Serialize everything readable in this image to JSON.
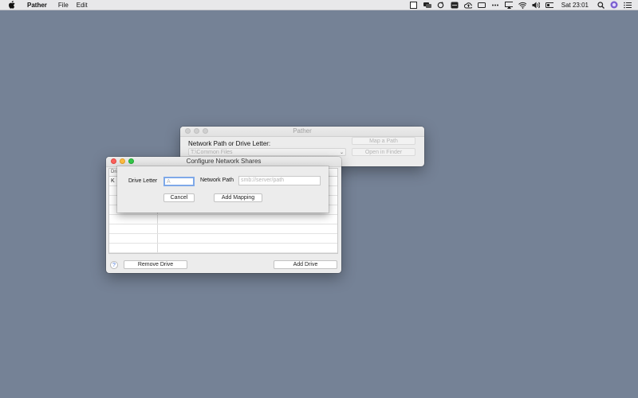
{
  "menubar": {
    "app_name": "Pather",
    "menus": [
      "File",
      "Edit"
    ],
    "clock": "Sat 23:01"
  },
  "pather_window": {
    "title": "Pather",
    "label": "Network Path or Drive Letter:",
    "combo_value": "T:\\Common Files",
    "map_button": "Map a Path",
    "open_button": "Open in Finder"
  },
  "config_window": {
    "title": "Configure Network Shares",
    "table_header": "Dri",
    "first_row_letter": "K",
    "help": "?",
    "remove_button": "Remove Drive",
    "add_button": "Add Drive"
  },
  "sheet": {
    "drive_letter_label": "Drive Letter",
    "drive_letter_placeholder": "A",
    "network_path_label": "Network Path",
    "network_path_placeholder": "smb://server/path",
    "cancel_button": "Cancel",
    "add_mapping_button": "Add Mapping"
  },
  "colors": {
    "desktop": "#758296",
    "window_bg": "#ececec",
    "focus_ring": "#7fa9e8"
  }
}
